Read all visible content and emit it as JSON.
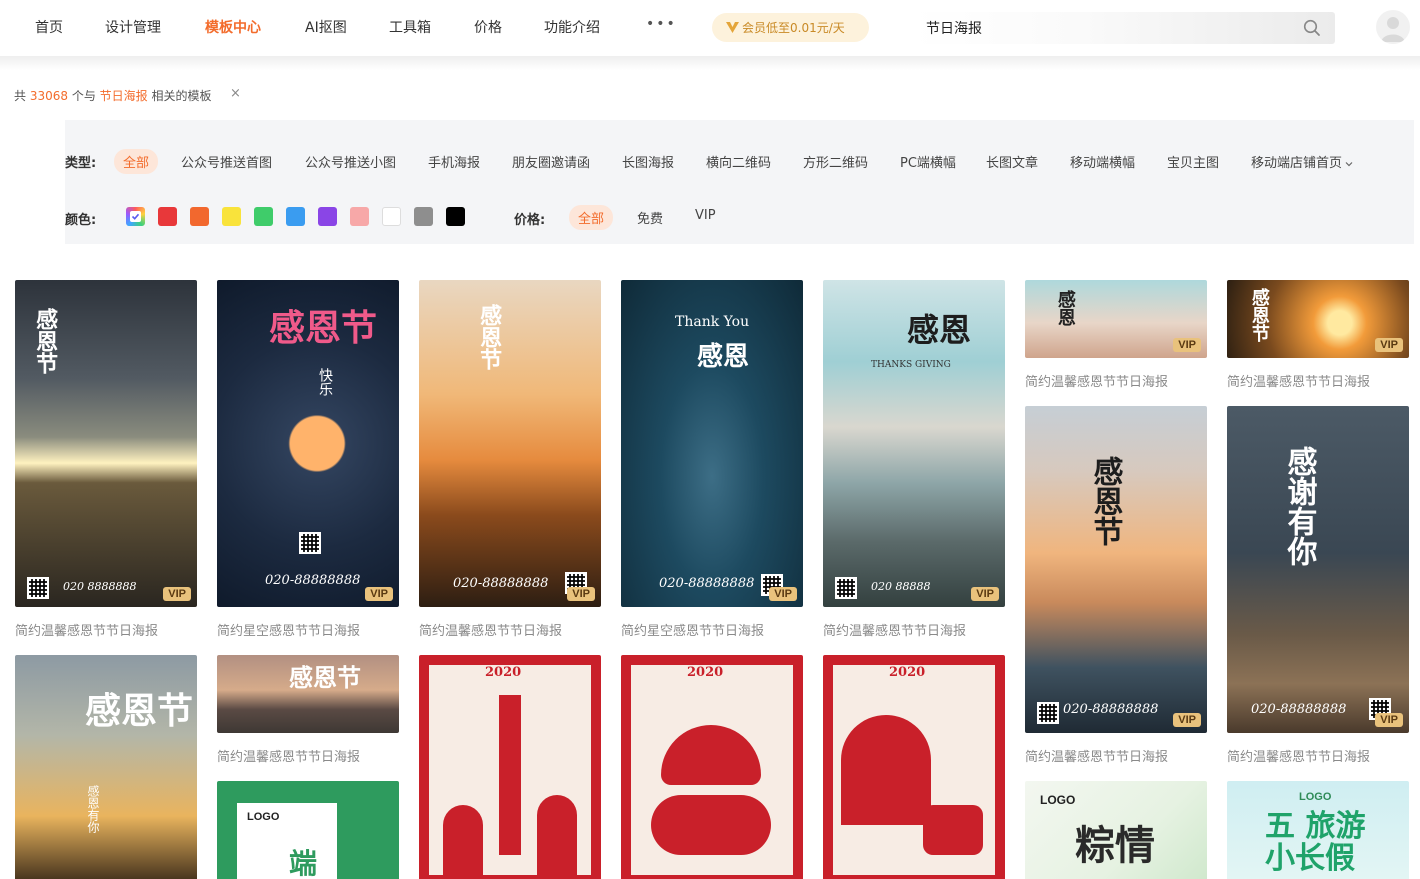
{
  "nav": {
    "items": [
      "首页",
      "设计管理",
      "模板中心",
      "AI抠图",
      "工具箱",
      "价格",
      "功能介绍"
    ],
    "active_index": 2,
    "more": "•••",
    "vip_promo": "会员低至0.01元/天"
  },
  "search": {
    "value": "节日海报",
    "placeholder": ""
  },
  "results": {
    "prefix": "共 ",
    "count": "33068",
    "middle": " 个与 ",
    "keyword": "节日海报",
    "suffix": " 相关的模板",
    "clear": "×"
  },
  "filters": {
    "type_label": "类型:",
    "types": [
      "全部",
      "公众号推送首图",
      "公众号推送小图",
      "手机海报",
      "朋友圈邀请函",
      "长图海报",
      "横向二维码",
      "方形二维码",
      "PC端横幅",
      "长图文章",
      "移动端横幅",
      "宝贝主图",
      "移动端店铺首页"
    ],
    "color_label": "颜色:",
    "colors": [
      "all",
      "#e8383a",
      "#f2682e",
      "#f9e33b",
      "#3fcc6a",
      "#3a9cf0",
      "#8a45e6",
      "#f7a8a8",
      "#ffffff",
      "#8e8e8e",
      "#000000"
    ],
    "price_label": "价格:",
    "prices": [
      "全部",
      "免费",
      "VIP"
    ]
  },
  "accent_color": "#f36c2c",
  "cards": [
    {
      "title": "简约温馨感恩节节日海报",
      "overlay": "感恩节",
      "phone": "020 8888888",
      "vip": "VIP"
    },
    {
      "title": "简约星空感恩节节日海报",
      "overlay": "感恩节",
      "overlay2": "快乐",
      "phone": "020-88888888",
      "vip": "VIP"
    },
    {
      "title": "简约温馨感恩节节日海报",
      "overlay": "感恩节",
      "phone": "020-88888888",
      "vip": "VIP"
    },
    {
      "title": "简约星空感恩节节日海报",
      "overlay": "感恩",
      "overlay2": "Thank You",
      "phone": "020-88888888",
      "vip": "VIP"
    },
    {
      "title": "简约温馨感恩节节日海报",
      "overlay": "感恩",
      "overlay2": "THANKS GIVING",
      "phone": "020 88888",
      "vip": "VIP"
    },
    {
      "title": "简约温馨感恩节节日海报",
      "overlay": "感恩",
      "vip": "VIP"
    },
    {
      "title": "简约温馨感恩节节日海报",
      "overlay": "感恩节",
      "vip": "VIP"
    },
    {
      "title": "简约温馨感恩节节日海报",
      "overlay": "感恩节",
      "phone": "020-88888888",
      "vip": "VIP"
    },
    {
      "title": "简约温馨感恩节节日海报",
      "overlay": "感谢有你",
      "phone": "020-88888888",
      "vip": "VIP"
    },
    {
      "title": "",
      "overlay": "感恩节",
      "overlay2": "感恩有你"
    },
    {
      "title": "简约温馨感恩节节日海报",
      "overlay": "感恩节"
    },
    {
      "title": "",
      "overlay": "LOGO",
      "overlay2": "端"
    },
    {
      "title": "",
      "overlay": "2020"
    },
    {
      "title": "",
      "overlay": "2020"
    },
    {
      "title": "",
      "overlay": "2020"
    },
    {
      "title": "",
      "overlay": "LOGO",
      "overlay2": "粽情"
    },
    {
      "title": "",
      "overlay": "LOGO",
      "overlay2": "五 旅游 小长假"
    }
  ]
}
